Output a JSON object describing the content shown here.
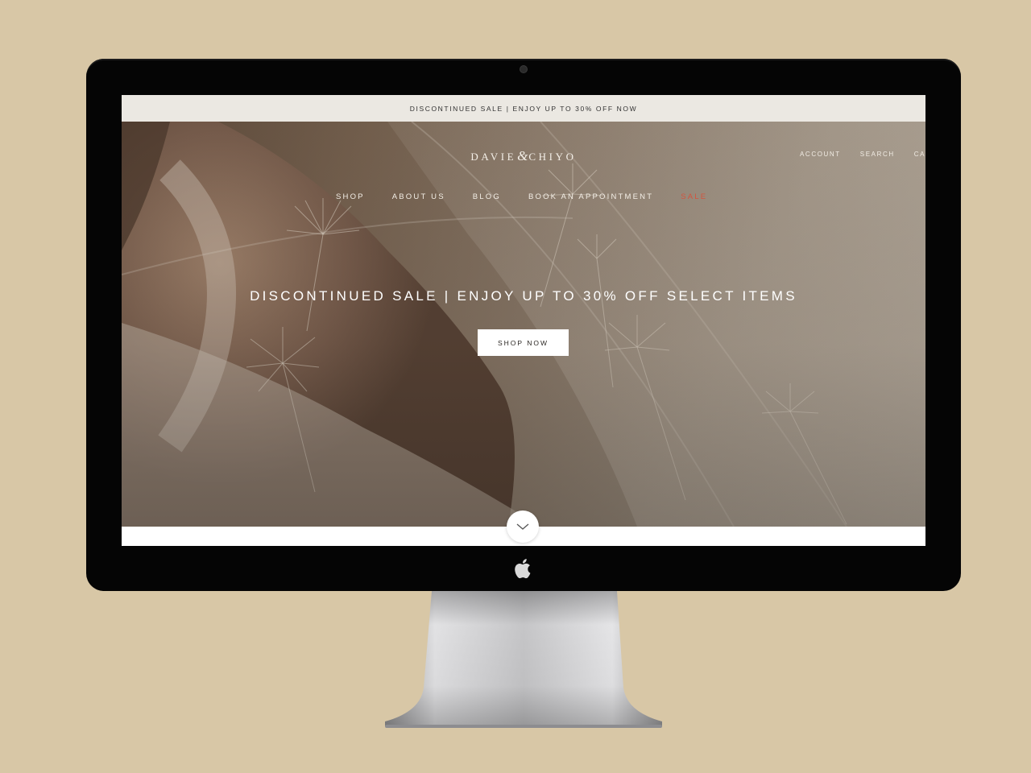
{
  "announcement": {
    "text": "DISCONTINUED SALE | ENJOY UP TO 30% OFF NOW"
  },
  "header": {
    "logo_left": "DAVIE",
    "logo_amp": "&",
    "logo_right": "CHIYO",
    "utils": {
      "account": "ACCOUNT",
      "search": "SEARCH",
      "cart_partial": "CA"
    }
  },
  "nav": {
    "items": [
      {
        "label": "SHOP"
      },
      {
        "label": "ABOUT US"
      },
      {
        "label": "BLOG"
      },
      {
        "label": "BOOK AN APPOINTMENT"
      },
      {
        "label": "SALE"
      }
    ],
    "sale_color": "#d2553f"
  },
  "hero": {
    "heading": "DISCONTINUED SALE | ENJOY UP TO 30% OFF SELECT ITEMS",
    "cta": "SHOP NOW"
  },
  "icons": {
    "scroll": "chevron-down-icon",
    "monitor_logo": "apple-icon",
    "camera": "camera-icon"
  },
  "colors": {
    "background": "#d8c7a6",
    "bezel": "#050505",
    "announcement_bg": "#ebe8e2"
  }
}
